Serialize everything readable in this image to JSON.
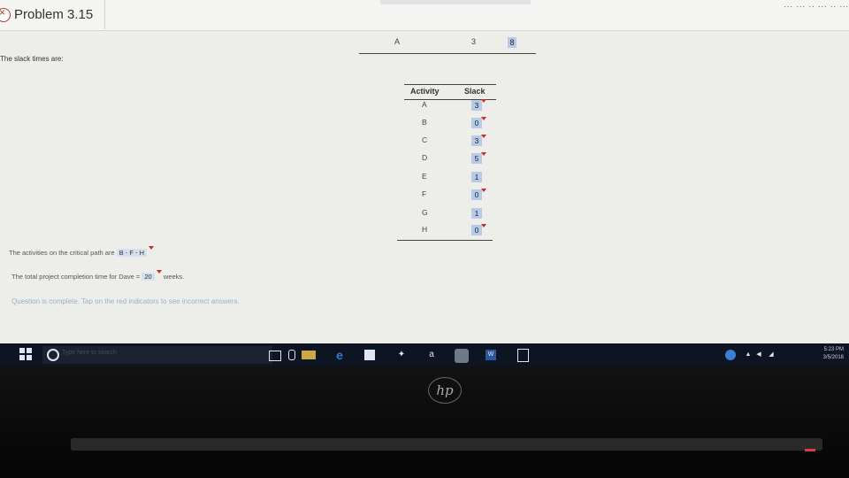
{
  "header": {
    "title": "Problem 3.15",
    "score_text": "... ... .. ... .. ..."
  },
  "intro": "The slack times are:",
  "top_row": {
    "col_a": "A",
    "col_b": "3",
    "badge": "8"
  },
  "slack_table": {
    "headers": {
      "activity": "Activity",
      "slack": "Slack"
    },
    "rows": [
      {
        "activity": "A",
        "slack": "3"
      },
      {
        "activity": "B",
        "slack": "0"
      },
      {
        "activity": "C",
        "slack": "3"
      },
      {
        "activity": "D",
        "slack": "5"
      },
      {
        "activity": "E",
        "slack": "1"
      },
      {
        "activity": "F",
        "slack": "0"
      },
      {
        "activity": "G",
        "slack": "1"
      },
      {
        "activity": "H",
        "slack": "0"
      }
    ]
  },
  "critical_path": {
    "prefix": "The activities on the critical path are",
    "value": "B - F - H"
  },
  "completion": {
    "prefix": "The total project completion time for Dave =",
    "value": "20",
    "suffix": "weeks."
  },
  "status_note": "Question is complete. Tap on the red indicators to see incorrect answers.",
  "taskbar": {
    "search_placeholder": "Type here to search",
    "amazon_label": "a",
    "word_label": "W",
    "time": "5:23 PM",
    "date": "3/5/2018"
  },
  "bezel": {
    "brand": "hp"
  }
}
